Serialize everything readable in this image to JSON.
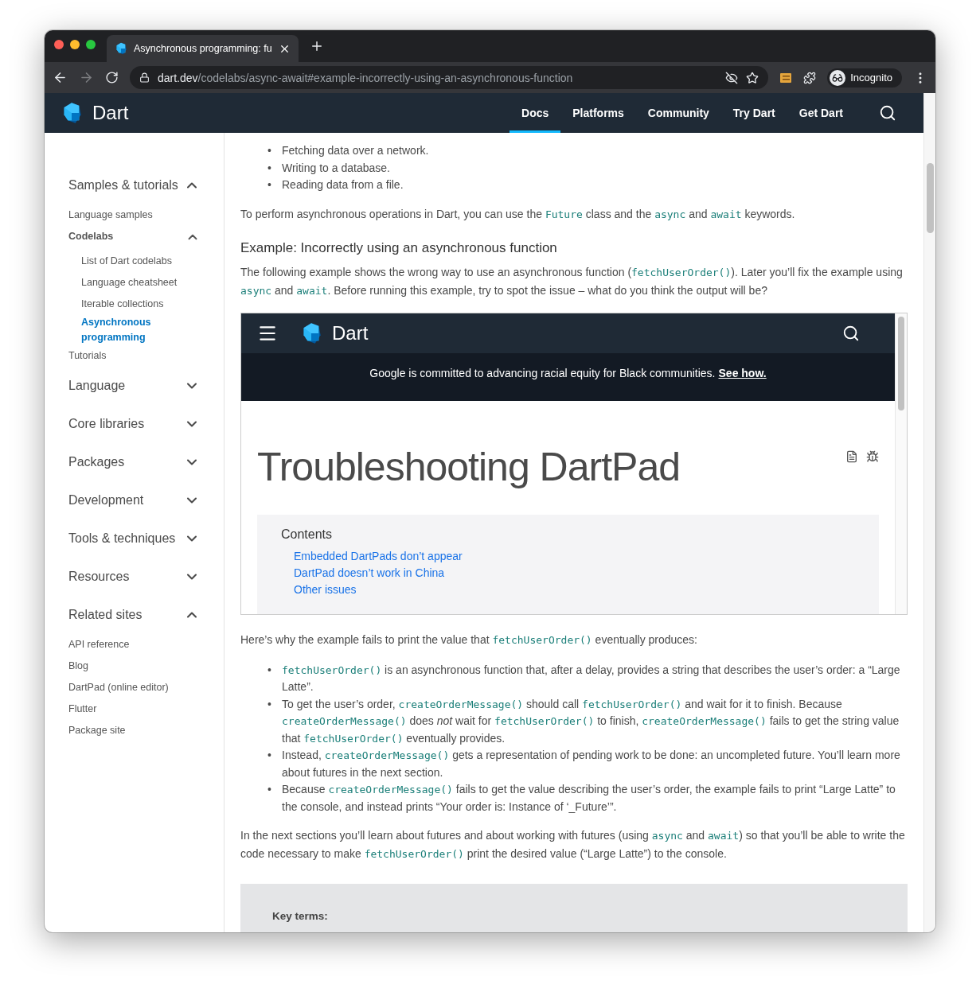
{
  "browser": {
    "tab_title": "Asynchronous programming: fu",
    "url_host": "dart.dev",
    "url_path": "/codelabs/async-await#example-incorrectly-using-an-asynchronous-function",
    "profile": "Incognito"
  },
  "header": {
    "brand": "Dart",
    "nav": [
      {
        "label": "Docs",
        "selected": true
      },
      {
        "label": "Platforms",
        "selected": false
      },
      {
        "label": "Community",
        "selected": false
      },
      {
        "label": "Try Dart",
        "selected": false
      },
      {
        "label": "Get Dart",
        "selected": false
      }
    ]
  },
  "sidebar": [
    {
      "label": "Samples & tutorials",
      "expanded": true,
      "children": [
        {
          "label": "Language samples",
          "selected": false
        },
        {
          "label": "Codelabs",
          "selected": false,
          "expanded": true,
          "children": [
            {
              "label": "List of Dart codelabs",
              "selected": false
            },
            {
              "label": "Language cheatsheet",
              "selected": false
            },
            {
              "label": "Iterable collections",
              "selected": false
            },
            {
              "label": "Asynchronous programming",
              "selected": true
            }
          ]
        },
        {
          "label": "Tutorials",
          "selected": false
        }
      ]
    },
    {
      "label": "Language",
      "expanded": false
    },
    {
      "label": "Core libraries",
      "expanded": false
    },
    {
      "label": "Packages",
      "expanded": false
    },
    {
      "label": "Development",
      "expanded": false
    },
    {
      "label": "Tools & techniques",
      "expanded": false
    },
    {
      "label": "Resources",
      "expanded": false
    },
    {
      "label": "Related sites",
      "expanded": true,
      "children": [
        {
          "label": "API reference",
          "selected": false
        },
        {
          "label": "Blog",
          "selected": false
        },
        {
          "label": "DartPad (online editor)",
          "selected": false
        },
        {
          "label": "Flutter",
          "selected": false
        },
        {
          "label": "Package site",
          "selected": false
        }
      ]
    }
  ],
  "content": [
    {
      "kind": "bullets",
      "marker": "•",
      "items": [
        [
          "Fetching data over a network."
        ],
        [
          "Writing to a database."
        ],
        [
          "Reading data from a file."
        ]
      ]
    },
    {
      "kind": "paragraph",
      "segments": [
        "To perform asynchronous operations in Dart, you can use the ",
        {
          "code": "Future"
        },
        " class and the ",
        {
          "code": "async"
        },
        " and ",
        {
          "code": "await"
        },
        " keywords."
      ]
    },
    {
      "kind": "heading",
      "text": "Example: Incorrectly using an asynchronous function"
    },
    {
      "kind": "paragraph",
      "segments": [
        "The following example shows the wrong way to use an asynchronous function (",
        {
          "code": "fetchUserOrder()"
        },
        "). Later you’ll fix the example using ",
        {
          "code": "async"
        },
        " and ",
        {
          "code": "await"
        },
        ". Before running this example, try to spot the issue – what do you think the output will be?"
      ]
    },
    {
      "kind": "embed",
      "brand": "Dart",
      "banner": "Google is committed to advancing racial equity for Black communities.",
      "banner_link": "See how.",
      "title": "Troubleshooting DartPad",
      "contents_title": "Contents",
      "contents": [
        "Embedded DartPads don’t appear",
        "DartPad doesn’t work in China",
        "Other issues"
      ]
    },
    {
      "kind": "paragraph",
      "segments": [
        "Here’s why the example fails to print the value that ",
        {
          "code": "fetchUserOrder()"
        },
        " eventually produces:"
      ]
    },
    {
      "kind": "bullets",
      "marker": "•",
      "items": [
        [
          {
            "code": "fetchUserOrder()"
          },
          " is an asynchronous function that, after a delay, provides a string that describes the user’s order: a “Large Latte”."
        ],
        [
          "To get the user’s order, ",
          {
            "code": "createOrderMessage()"
          },
          " should call ",
          {
            "code": "fetchUserOrder()"
          },
          " and wait for it to finish. Because ",
          {
            "code": "createOrderMessage()"
          },
          " does *not* wait for ",
          {
            "code": "fetchUserOrder()"
          },
          " to finish, ",
          {
            "code": "createOrderMessage()"
          },
          " fails to get the string value that ",
          {
            "code": "fetchUserOrder()"
          },
          " eventually provides."
        ],
        [
          "Instead, ",
          {
            "code": "createOrderMessage()"
          },
          " gets a representation of pending work to be done: an uncompleted future. You’ll learn more about futures in the next section."
        ],
        [
          "Because ",
          {
            "code": "createOrderMessage()"
          },
          " fails to get the value describing the user’s order, the example fails to print “Large Latte” to the console, and instead prints “Your order is: Instance of ‘_Future’”."
        ]
      ]
    },
    {
      "kind": "paragraph",
      "segments": [
        "In the next sections you’ll learn about futures and about working with futures (using ",
        {
          "code": "async"
        },
        " and ",
        {
          "code": "await"
        },
        ") so that you’ll be able to write the code necessary to make ",
        {
          "code": "fetchUserOrder()"
        },
        " print the desired value (“Large Latte”) to the console."
      ]
    },
    {
      "kind": "callout",
      "title": "Key terms:"
    }
  ]
}
